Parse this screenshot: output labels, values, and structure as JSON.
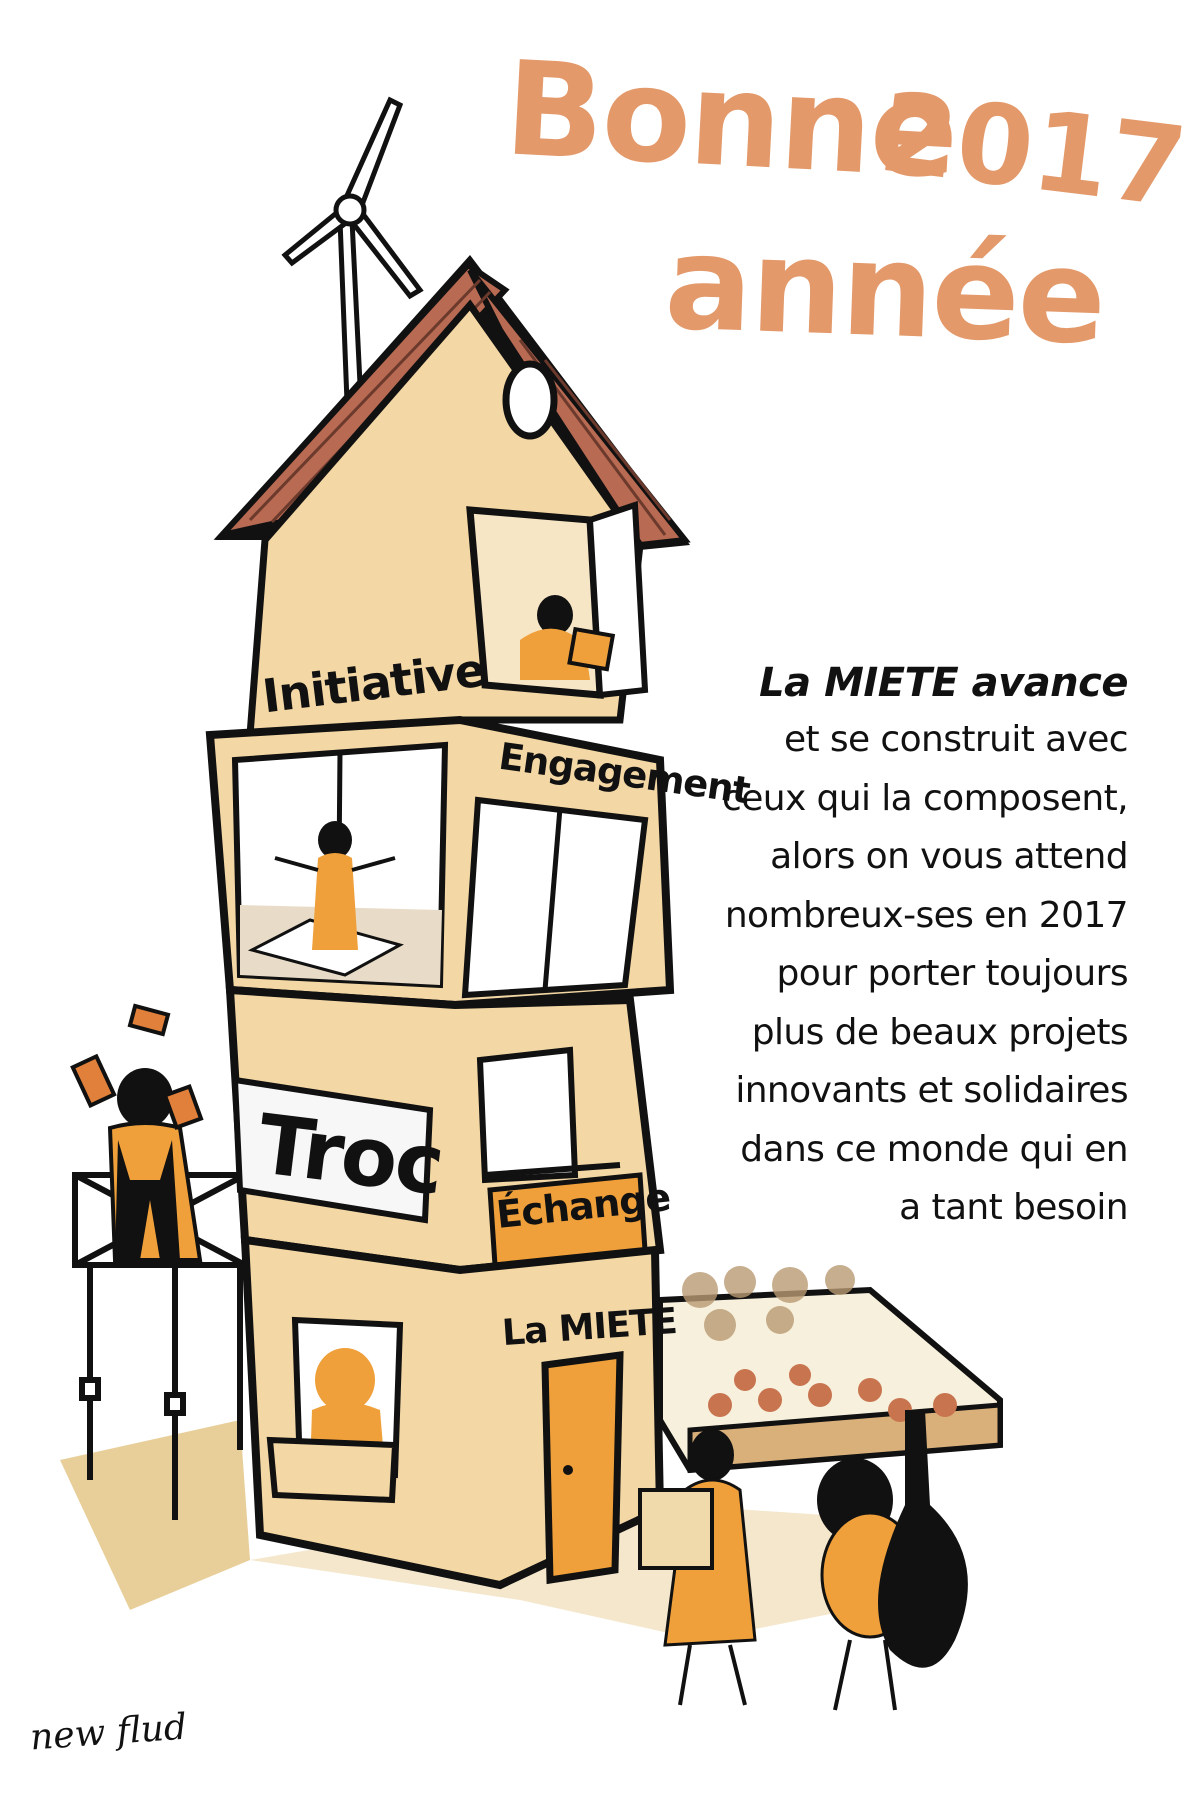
{
  "greeting": {
    "word1": "Bonne",
    "year": "2017",
    "word2": "année"
  },
  "message": {
    "heading": "La MIETE avance",
    "lines": [
      "et se construit avec",
      "ceux qui la composent,",
      "alors on vous attend",
      "nombreux-ses en 2017",
      "pour porter toujours",
      "plus de beaux projets",
      "innovants et solidaires",
      "dans ce monde qui en",
      "a tant besoin"
    ]
  },
  "house": {
    "labels": {
      "initiative": "Initiative",
      "engagement": "Engagement",
      "troc": "Troc",
      "echange": "Échange",
      "miete": "La MIETE"
    }
  },
  "signature": "new flud",
  "colors": {
    "title": "#e3996a",
    "wall": "#f3d7a4",
    "roof": "#b86a52",
    "orange": "#f0a03a",
    "ink": "#111111",
    "ground": "#e8cf9a"
  }
}
